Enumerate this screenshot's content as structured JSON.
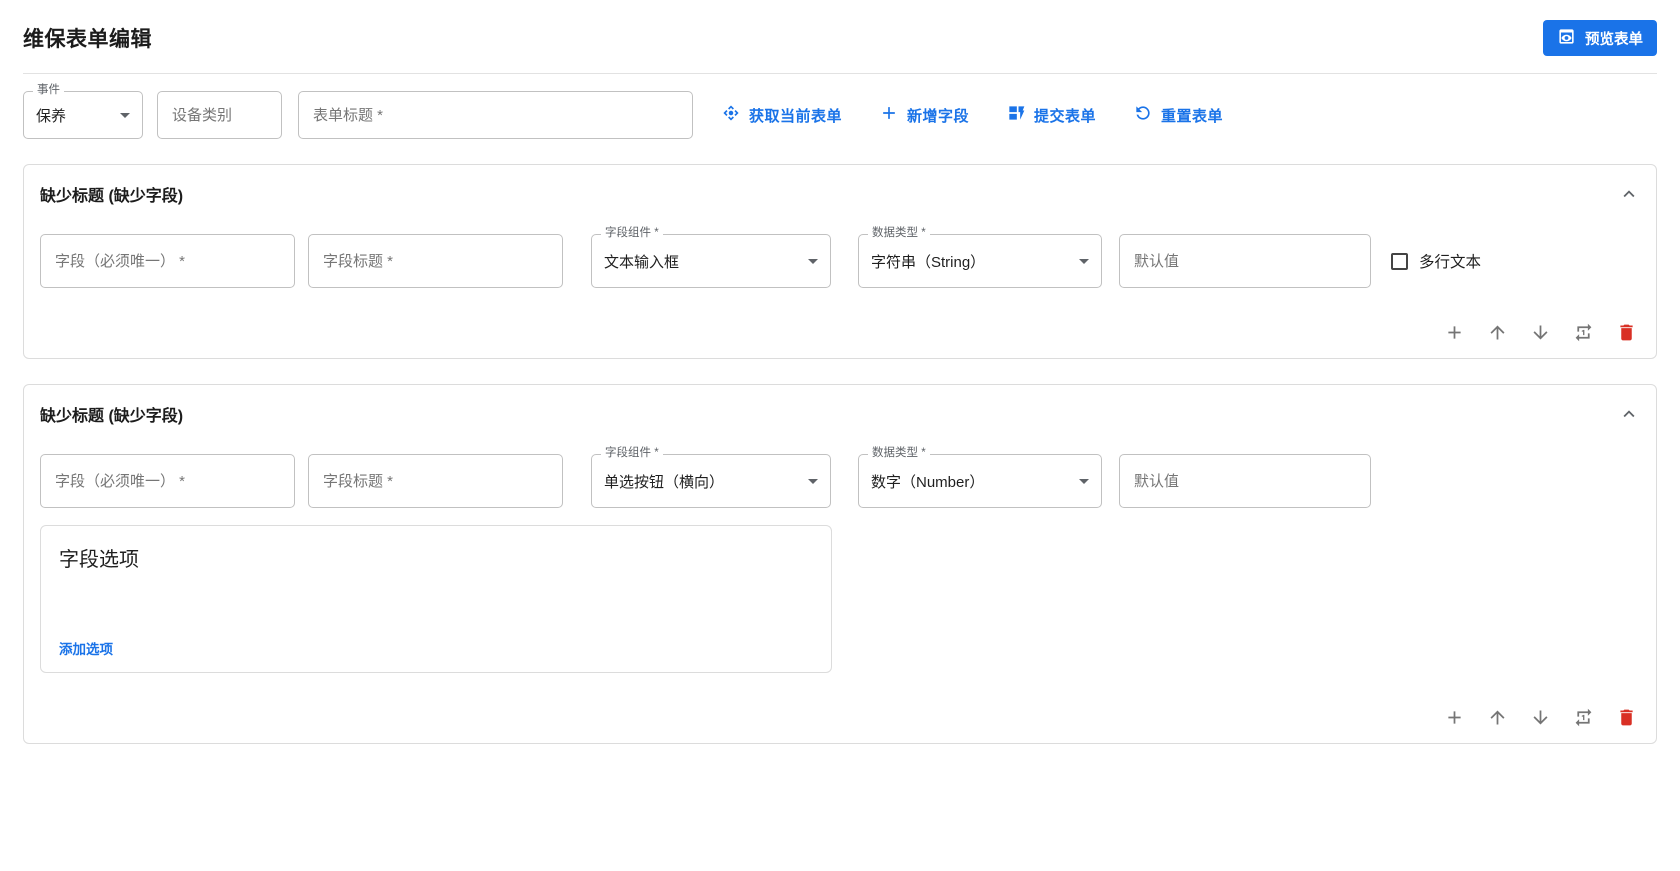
{
  "window": {
    "title": "维保表单编辑"
  },
  "header": {
    "preview_button": {
      "label": "预览表单",
      "icon": "preview-eye-icon"
    }
  },
  "toolbar": {
    "event_select": {
      "label": "事件",
      "value": "保养",
      "icon": "caret-down-icon"
    },
    "device_category_input": {
      "placeholder": "设备类别",
      "value": ""
    },
    "form_title_input": {
      "placeholder": "表单标题 *",
      "value": ""
    },
    "actions": [
      {
        "label": "获取当前表单",
        "icon": "four-direction-arrows-icon"
      },
      {
        "label": "新增字段",
        "icon": "plus-icon"
      },
      {
        "label": "提交表单",
        "icon": "dynamic-form-icon"
      },
      {
        "label": "重置表单",
        "icon": "rotate-left-icon"
      }
    ]
  },
  "cards": [
    {
      "title": "缺少标题 (缺少字段)",
      "collapse_icon": "chevron-up-icon",
      "fields": {
        "field_key": {
          "placeholder": "字段（必须唯一） *",
          "value": ""
        },
        "field_label": {
          "placeholder": "字段标题 *",
          "value": ""
        },
        "component": {
          "label": "字段组件 *",
          "value": "文本输入框"
        },
        "data_type": {
          "label": "数据类型 *",
          "value": "字符串（String）"
        },
        "default_value": {
          "placeholder": "默认值",
          "value": ""
        }
      },
      "multiline_checkbox": {
        "label": "多行文本",
        "checked": false
      },
      "footer_icons": [
        "plus-icon",
        "arrow-up-icon",
        "arrow-down-icon",
        "repeat-one-icon",
        "trash-icon"
      ]
    },
    {
      "title": "缺少标题 (缺少字段)",
      "collapse_icon": "chevron-up-icon",
      "fields": {
        "field_key": {
          "placeholder": "字段（必须唯一） *",
          "value": ""
        },
        "field_label": {
          "placeholder": "字段标题 *",
          "value": ""
        },
        "component": {
          "label": "字段组件 *",
          "value": "单选按钮（横向）"
        },
        "data_type": {
          "label": "数据类型 *",
          "value": "数字（Number）"
        },
        "default_value": {
          "placeholder": "默认值",
          "value": ""
        }
      },
      "options_box": {
        "title": "字段选项",
        "add_option_link": "添加选项"
      },
      "footer_icons": [
        "plus-icon",
        "arrow-up-icon",
        "arrow-down-icon",
        "repeat-one-icon",
        "trash-icon"
      ]
    }
  ],
  "colors": {
    "accent_blue": "#1a73e8",
    "danger_red": "#d93025",
    "icon_gray": "#757575",
    "input_border": "#c1c1c1",
    "card_border": "#dcdcdc",
    "text_dark": "#1f1f1f",
    "label_gray": "#5f6368",
    "placeholder_gray": "#767676"
  }
}
